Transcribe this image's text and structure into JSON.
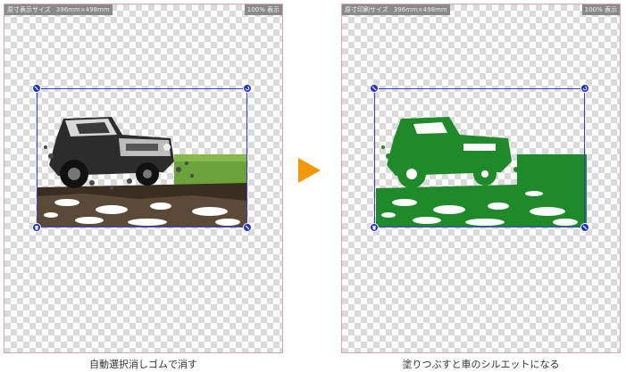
{
  "left_panel": {
    "info_label": "原寸表示サイズ",
    "info_size": "396mm×498mm",
    "zoom": "100% 表示",
    "caption": "自動選択消しゴムで消す"
  },
  "right_panel": {
    "info_label": "原寸印刷サイズ",
    "info_size": "396mm×498mm",
    "zoom": "100% 表示",
    "caption": "塗りつぶすと車のシルエットになる"
  },
  "colors": {
    "selection": "#3a3ad8",
    "handle": "#1f2fd1",
    "arrow": "#f39800",
    "silhouette": "#1f8a2a",
    "grass": "#6aa33a"
  },
  "icons": {
    "arrow": "play-triangle-icon",
    "rotate": "rotate-icon",
    "resize": "resize-icon",
    "delete": "trash-icon"
  }
}
